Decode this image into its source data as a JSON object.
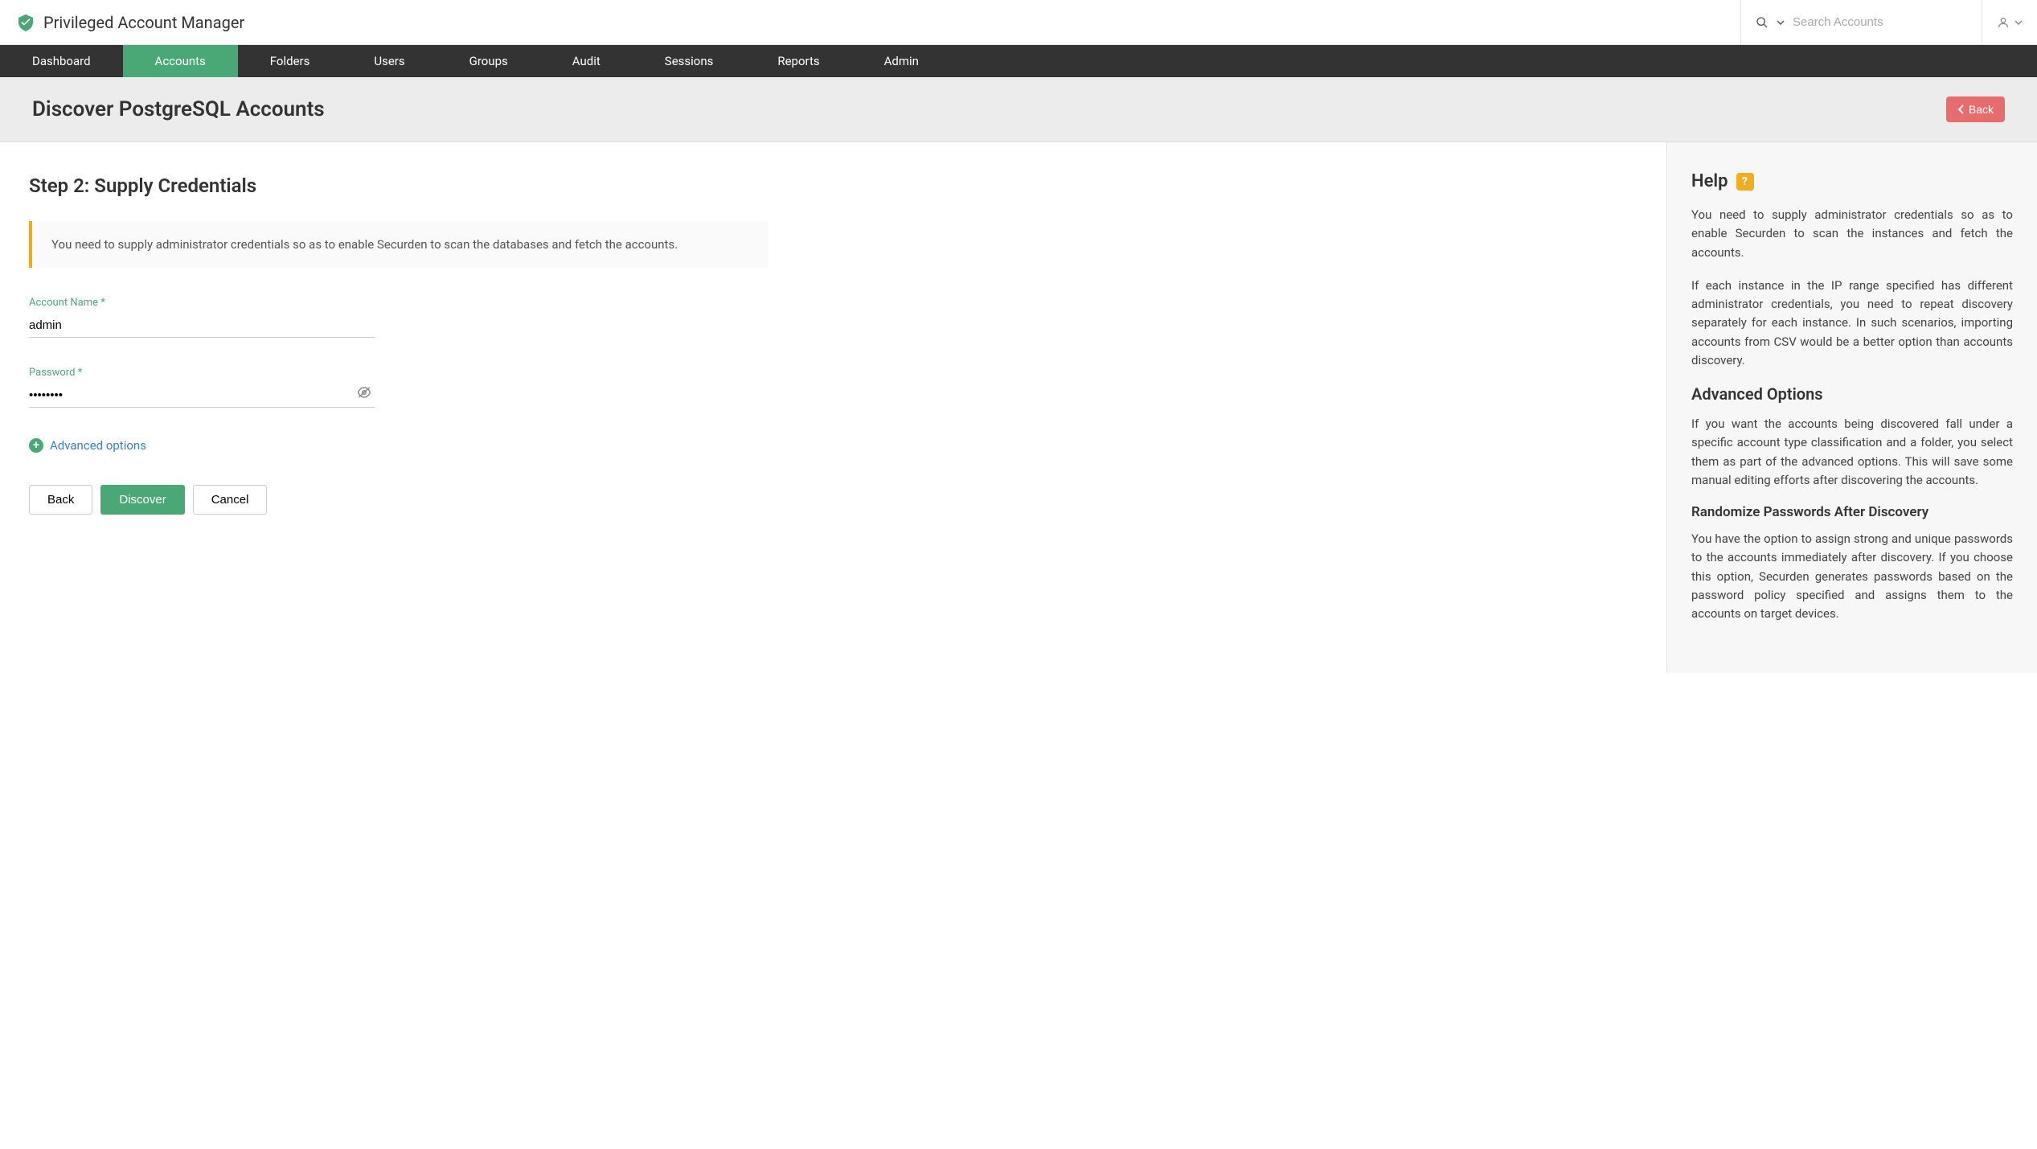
{
  "brand": {
    "name": "Privileged Account Manager"
  },
  "search": {
    "placeholder": "Search Accounts"
  },
  "nav": {
    "items": [
      {
        "label": "Dashboard",
        "active": false
      },
      {
        "label": "Accounts",
        "active": true
      },
      {
        "label": "Folders",
        "active": false
      },
      {
        "label": "Users",
        "active": false
      },
      {
        "label": "Groups",
        "active": false
      },
      {
        "label": "Audit",
        "active": false
      },
      {
        "label": "Sessions",
        "active": false
      },
      {
        "label": "Reports",
        "active": false
      },
      {
        "label": "Admin",
        "active": false
      }
    ]
  },
  "page": {
    "title": "Discover PostgreSQL Accounts",
    "back_label": "Back"
  },
  "main": {
    "step_title": "Step 2: Supply Credentials",
    "info_text": "You need to supply administrator credentials so as to enable Securden to scan the databases and fetch the accounts.",
    "account_name_label": "Account Name *",
    "account_name_value": "admin",
    "password_label": "Password *",
    "password_value": "••••••••",
    "advanced_link": "Advanced options",
    "buttons": {
      "back": "Back",
      "discover": "Discover",
      "cancel": "Cancel"
    }
  },
  "help": {
    "title": "Help",
    "badge": "?",
    "p1": "You need to supply administrator credentials so as to enable Securden to scan the instances and fetch the accounts.",
    "p2": "If each instance in the IP range specified has different administrator credentials, you need to repeat discovery separately for each instance. In such scenarios, importing accounts from CSV would be a better option than accounts discovery.",
    "h2": "Advanced Options",
    "p3": "If you want the accounts being discovered fall under a specific account type classification and a folder, you select them as part of the advanced options. This will save some manual editing efforts after discovering the accounts.",
    "h3": "Randomize Passwords After Discovery",
    "p4": "You have the option to assign strong and unique passwords to the accounts immediately after discovery. If you choose this option, Securden generates passwords based on the password policy specified and assigns them to the accounts on target devices."
  }
}
